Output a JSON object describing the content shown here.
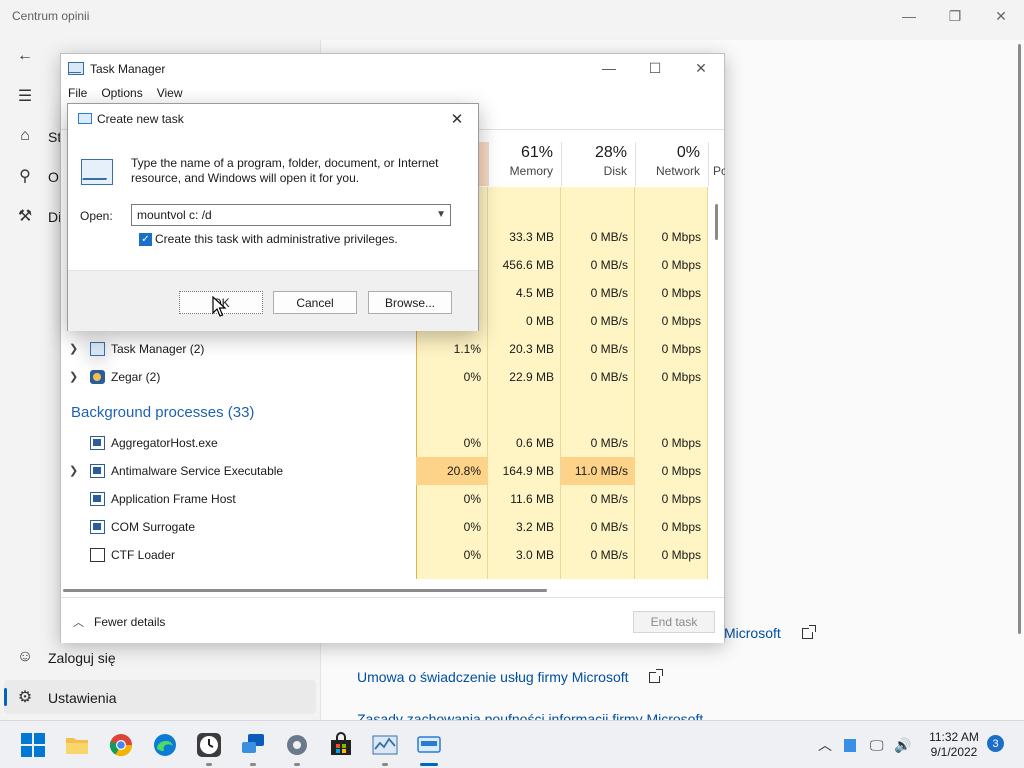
{
  "background_app": {
    "title": "Centrum opinii",
    "nav_items": [
      {
        "label": "St",
        "icon": "home-icon"
      },
      {
        "label": "O",
        "icon": "feedback-icon"
      },
      {
        "label": "Di",
        "icon": "diagnostics-icon"
      }
    ],
    "bottom_items": [
      {
        "label": "Zaloguj się",
        "icon": "person-icon"
      },
      {
        "label": "Ustawienia",
        "icon": "gear-icon"
      }
    ],
    "links": [
      {
        "label": "Microsoft"
      },
      {
        "label": "Umowa o świadczenie usług firmy Microsoft"
      },
      {
        "label": "Zasady zachowania poufności informacji firmy Microsoft"
      }
    ]
  },
  "task_manager": {
    "title": "Task Manager",
    "menu": [
      "File",
      "Options",
      "View"
    ],
    "columns": [
      {
        "pct": "",
        "label": ""
      },
      {
        "pct": "61%",
        "label": "Memory"
      },
      {
        "pct": "28%",
        "label": "Disk"
      },
      {
        "pct": "0%",
        "label": "Network"
      },
      {
        "pct": "",
        "label": "Po"
      }
    ],
    "partial_rows": [
      {
        "mem": "33.3 MB",
        "disk": "0 MB/s",
        "net": "0 Mbps"
      },
      {
        "mem": "456.6 MB",
        "disk": "0 MB/s",
        "net": "0 Mbps"
      },
      {
        "mem": "4.5 MB",
        "disk": "0 MB/s",
        "net": "0 Mbps"
      },
      {
        "mem": "0 MB",
        "disk": "0 MB/s",
        "net": "0 Mbps"
      }
    ],
    "app_rows": [
      {
        "name": "Task Manager (2)",
        "cpu": "1.1%",
        "mem": "20.3 MB",
        "disk": "0 MB/s",
        "net": "0 Mbps",
        "icon": "task-manager-icon"
      },
      {
        "name": "Zegar (2)",
        "cpu": "0%",
        "mem": "22.9 MB",
        "disk": "0 MB/s",
        "net": "0 Mbps",
        "icon": "clock-icon"
      }
    ],
    "group_background": "Background processes (33)",
    "bg_rows": [
      {
        "name": "AggregatorHost.exe",
        "cpu": "0%",
        "mem": "0.6 MB",
        "disk": "0 MB/s",
        "net": "0 Mbps"
      },
      {
        "name": "Antimalware Service Executable",
        "cpu": "20.8%",
        "mem": "164.9 MB",
        "disk": "11.0 MB/s",
        "net": "0 Mbps"
      },
      {
        "name": "Application Frame Host",
        "cpu": "0%",
        "mem": "11.6 MB",
        "disk": "0 MB/s",
        "net": "0 Mbps"
      },
      {
        "name": "COM Surrogate",
        "cpu": "0%",
        "mem": "3.2 MB",
        "disk": "0 MB/s",
        "net": "0 Mbps"
      },
      {
        "name": "CTF Loader",
        "cpu": "0%",
        "mem": "3.0 MB",
        "disk": "0 MB/s",
        "net": "0 Mbps"
      }
    ],
    "fewer_details": "Fewer details",
    "end_task": "End task"
  },
  "dialog": {
    "title": "Create new task",
    "message": "Type the name of a program, folder, document, or Internet resource, and Windows will open it for you.",
    "open_label": "Open:",
    "open_value": "mountvol c: /d",
    "admin_checked": true,
    "admin_label": "Create this task with administrative privileges.",
    "ok": "OK",
    "cancel": "Cancel",
    "browse": "Browse..."
  },
  "taskbar": {
    "apps": [
      "start",
      "file-explorer",
      "chrome",
      "edge",
      "clock",
      "feedback-hub",
      "settings",
      "store",
      "task-manager",
      "run-dialog"
    ],
    "time": "11:32 AM",
    "date": "9/1/2022",
    "notifications": "3"
  },
  "colors": {
    "accent": "#0067c0",
    "heat_low": "#fff4c4",
    "heat_high": "#fdd38a",
    "link": "#0050a0"
  }
}
